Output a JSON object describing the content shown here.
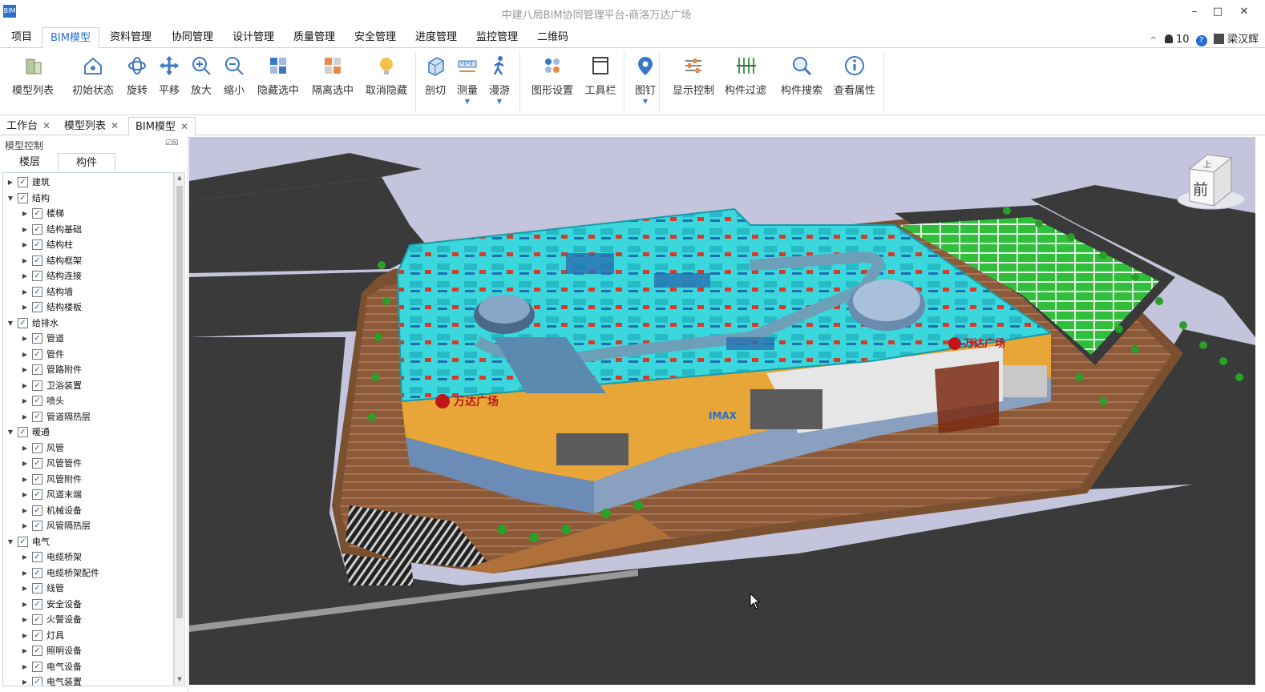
{
  "window": {
    "title": "中建八局BIM协同管理平台-商洛万达广场",
    "icon_text": "BIM",
    "minimize": "–",
    "maximize": "□",
    "close": "✕"
  },
  "menu": {
    "items": [
      "项目",
      "BIM模型",
      "资料管理",
      "协同管理",
      "设计管理",
      "质量管理",
      "安全管理",
      "进度管理",
      "监控管理",
      "二维码"
    ],
    "active": "BIM模型"
  },
  "menu_right": {
    "collapse": "^",
    "bell_count": "10",
    "help": "?",
    "user": "梁汉辉"
  },
  "ribbon": [
    {
      "label": "模型列表",
      "icon": "building-list-icon"
    },
    {
      "label": "初始状态",
      "icon": "home-icon"
    },
    {
      "label": "旋转",
      "icon": "rotate-icon"
    },
    {
      "label": "平移",
      "icon": "move-icon"
    },
    {
      "label": "放大",
      "icon": "zoom-in-icon"
    },
    {
      "label": "缩小",
      "icon": "zoom-out-icon"
    },
    {
      "label": "隐藏选中",
      "icon": "hide-selected-icon"
    },
    {
      "label": "隔离选中",
      "icon": "isolate-selected-icon"
    },
    {
      "label": "取消隐藏",
      "icon": "unhide-icon"
    },
    {
      "label": "剖切",
      "icon": "section-box-icon"
    },
    {
      "label": "测量",
      "icon": "measure-icon"
    },
    {
      "label": "漫游",
      "icon": "walk-icon"
    },
    {
      "label": "图形设置",
      "icon": "graphic-settings-icon"
    },
    {
      "label": "工具栏",
      "icon": "toolbar-icon"
    },
    {
      "label": "图钉",
      "icon": "pin-icon"
    },
    {
      "label": "显示控制",
      "icon": "display-control-icon"
    },
    {
      "label": "构件过滤",
      "icon": "component-filter-icon"
    },
    {
      "label": "构件搜索",
      "icon": "component-search-icon"
    },
    {
      "label": "查看属性",
      "icon": "properties-icon"
    }
  ],
  "tabs": [
    {
      "label": "工作台",
      "close": "✕"
    },
    {
      "label": "模型列表",
      "close": "✕"
    },
    {
      "label": "BIM模型",
      "close": "✕"
    }
  ],
  "panel": {
    "title": "模型控制",
    "pin": "☑☒",
    "tabs": [
      "楼层",
      "构件"
    ],
    "active_tab": "构件"
  },
  "tree": [
    {
      "label": "建筑",
      "level": 0,
      "expanded": false
    },
    {
      "label": "结构",
      "level": 0,
      "expanded": true
    },
    {
      "label": "楼梯",
      "level": 1
    },
    {
      "label": "结构基础",
      "level": 1
    },
    {
      "label": "结构柱",
      "level": 1
    },
    {
      "label": "结构框架",
      "level": 1
    },
    {
      "label": "结构连接",
      "level": 1
    },
    {
      "label": "结构墙",
      "level": 1
    },
    {
      "label": "结构楼板",
      "level": 1
    },
    {
      "label": "给排水",
      "level": 0,
      "expanded": true
    },
    {
      "label": "管道",
      "level": 1
    },
    {
      "label": "管件",
      "level": 1
    },
    {
      "label": "管路附件",
      "level": 1
    },
    {
      "label": "卫浴装置",
      "level": 1
    },
    {
      "label": "喷头",
      "level": 1
    },
    {
      "label": "管道隔热层",
      "level": 1
    },
    {
      "label": "暖通",
      "level": 0,
      "expanded": true
    },
    {
      "label": "风管",
      "level": 1
    },
    {
      "label": "风管管件",
      "level": 1
    },
    {
      "label": "风管附件",
      "level": 1
    },
    {
      "label": "风道末端",
      "level": 1
    },
    {
      "label": "机械设备",
      "level": 1
    },
    {
      "label": "风管隔热层",
      "level": 1
    },
    {
      "label": "电气",
      "level": 0,
      "expanded": true
    },
    {
      "label": "电缆桥架",
      "level": 1
    },
    {
      "label": "电缆桥架配件",
      "level": 1
    },
    {
      "label": "线管",
      "level": 1
    },
    {
      "label": "安全设备",
      "level": 1
    },
    {
      "label": "火警设备",
      "level": 1
    },
    {
      "label": "灯具",
      "level": 1
    },
    {
      "label": "照明设备",
      "level": 1
    },
    {
      "label": "电气设备",
      "level": 1
    },
    {
      "label": "电气装置",
      "level": 1
    }
  ],
  "viewcube": {
    "top": "上",
    "front": "前"
  },
  "model": {
    "sign_left": "万达广场",
    "sign_right": "万达广场",
    "imax": "IMAX"
  },
  "colors": {
    "accent": "#2a6fd0",
    "viewport_bg": "#c4c4dc",
    "roof": "#33dde0",
    "facade": "#e7a637"
  }
}
